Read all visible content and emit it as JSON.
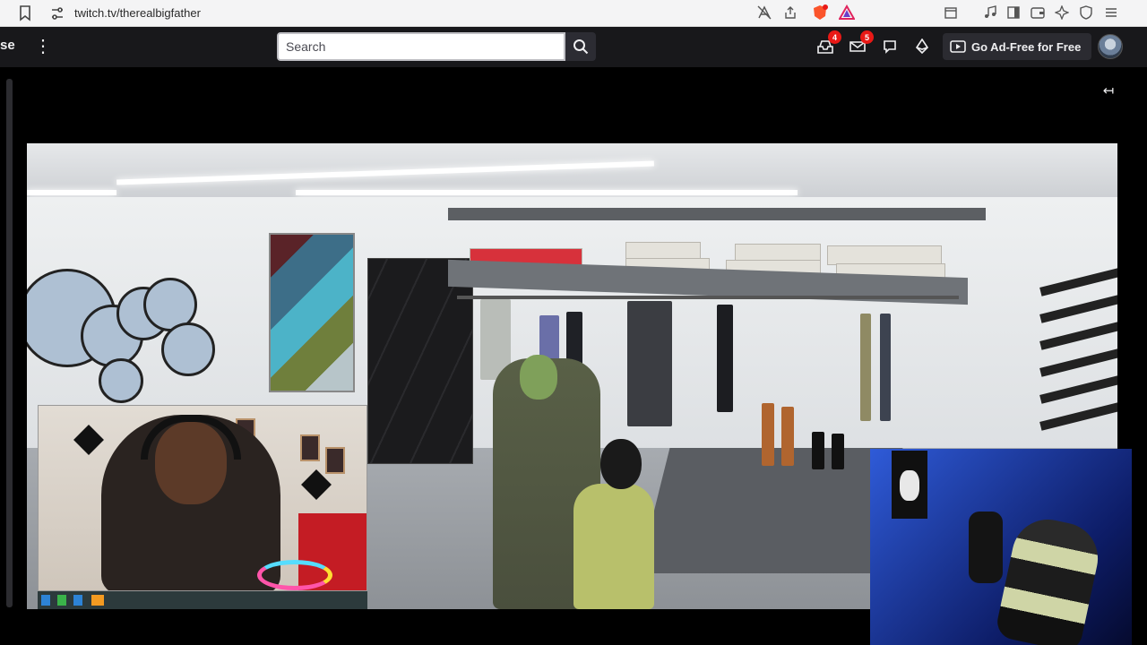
{
  "browser": {
    "url": "twitch.tv/therealbigfather"
  },
  "nav": {
    "logo_fragment": "se",
    "search_placeholder": "Search",
    "inbox_badge": "4",
    "whispers_badge": "5",
    "ad_free_label": "Go Ad-Free for Free"
  },
  "icons": {
    "bookmark": "bookmark-icon",
    "site_info": "site-settings-icon",
    "more": "more-vertical-icon",
    "search": "search-icon",
    "inbox": "inbox-icon",
    "whispers": "whispers-icon",
    "chat": "chat-bubble-icon",
    "bits": "bits-icon",
    "collapse": "collapse-arrow-icon"
  },
  "colors": {
    "twitch_nav": "#18181b",
    "badge_red": "#e91916",
    "browser_bar": "#f4f4f5"
  }
}
